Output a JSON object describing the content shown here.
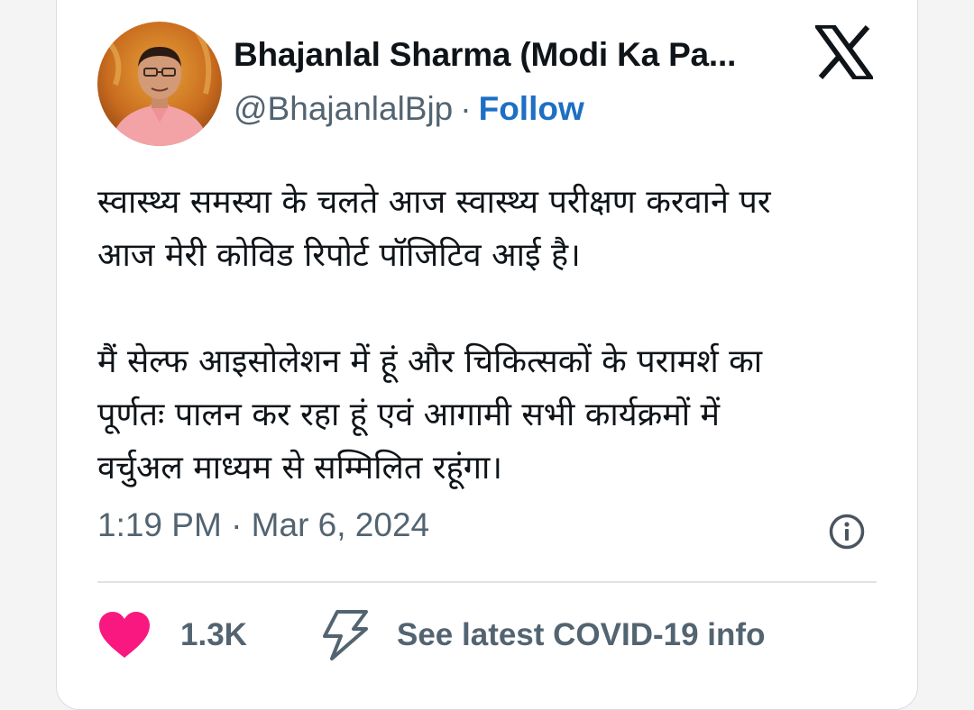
{
  "author": {
    "name": "Bhajanlal Sharma (Modi Ka Pa...",
    "handle": "@BhajanlalBjp",
    "separator": "·",
    "follow_label": "Follow"
  },
  "tweet": {
    "text": "स्वास्थ्य समस्या के चलते आज स्वास्थ्य परीक्षण करवाने पर\nआज मेरी कोविड रिपोर्ट पॉजिटिव आई है।\n\nमैं सेल्फ आइसोलेशन में हूं और चिकित्सकों के परामर्श का\nपूर्णतः पालन कर रहा हूं एवं आगामी सभी कार्यक्रमों में\nवर्चुअल माध्यम से सम्मिलित रहूंगा।",
    "timestamp": "1:19 PM · Mar 6, 2024"
  },
  "actions": {
    "like_count": "1.3K",
    "covid_info_label": "See latest COVID-19 info"
  },
  "icons": {
    "brand": "x-logo-icon",
    "info": "info-icon",
    "like": "heart-icon",
    "covid": "lightning-bolt-icon"
  },
  "colors": {
    "link": "#1d6fc4",
    "heart": "#f91880",
    "secondary_text": "#536471",
    "primary_text": "#0f1419"
  }
}
